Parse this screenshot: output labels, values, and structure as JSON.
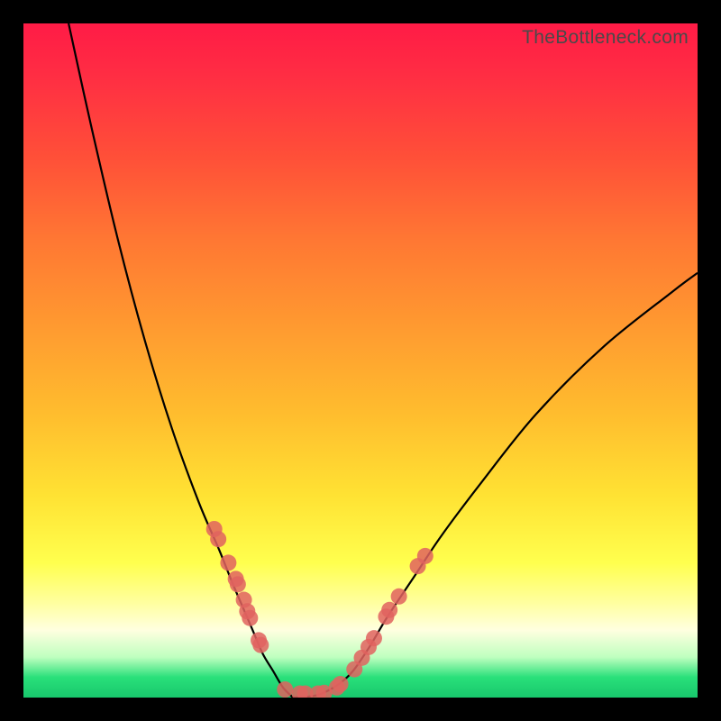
{
  "watermark": "TheBottleneck.com",
  "colors": {
    "frame": "#000000",
    "curve": "#000000",
    "dot": "#e0635f"
  },
  "chart_data": {
    "type": "line",
    "title": "",
    "xlabel": "",
    "ylabel": "",
    "xlim": [
      0,
      100
    ],
    "ylim": [
      0,
      100
    ],
    "series": [
      {
        "name": "left-curve",
        "x": [
          6.7,
          10,
          14,
          18,
          22,
          26,
          29,
          31,
          32.5,
          34,
          35.5,
          37,
          38.5,
          40
        ],
        "y": [
          100,
          85,
          68,
          53,
          40,
          29,
          22,
          17,
          13.5,
          10,
          6.5,
          4,
          1.5,
          0
        ]
      },
      {
        "name": "right-curve",
        "x": [
          40,
          44,
          48,
          51,
          54,
          58,
          62,
          68,
          76,
          86,
          96,
          100
        ],
        "y": [
          0,
          0.5,
          3,
          7,
          12,
          18,
          24,
          32,
          42,
          52,
          60,
          63
        ]
      }
    ],
    "points": [
      {
        "name": "left-cluster",
        "coords": [
          {
            "x": 28.3,
            "y": 25
          },
          {
            "x": 28.9,
            "y": 23.5
          },
          {
            "x": 30.4,
            "y": 20
          },
          {
            "x": 31.5,
            "y": 17.6
          },
          {
            "x": 31.8,
            "y": 16.8
          },
          {
            "x": 32.7,
            "y": 14.5
          },
          {
            "x": 33.2,
            "y": 12.8
          },
          {
            "x": 33.6,
            "y": 11.8
          },
          {
            "x": 34.9,
            "y": 8.5
          },
          {
            "x": 35.2,
            "y": 7.8
          }
        ]
      },
      {
        "name": "bottom-cluster",
        "coords": [
          {
            "x": 38.8,
            "y": 1.2
          },
          {
            "x": 41.0,
            "y": 0.6
          },
          {
            "x": 41.8,
            "y": 0.6
          },
          {
            "x": 43.7,
            "y": 0.6
          },
          {
            "x": 44.6,
            "y": 0.7
          },
          {
            "x": 46.5,
            "y": 1.5
          },
          {
            "x": 47.0,
            "y": 2.0
          }
        ]
      },
      {
        "name": "right-cluster",
        "coords": [
          {
            "x": 49.1,
            "y": 4.2
          },
          {
            "x": 50.2,
            "y": 5.9
          },
          {
            "x": 51.2,
            "y": 7.5
          },
          {
            "x": 52.0,
            "y": 8.8
          },
          {
            "x": 53.8,
            "y": 12.0
          },
          {
            "x": 54.3,
            "y": 13.0
          },
          {
            "x": 55.7,
            "y": 15.0
          },
          {
            "x": 58.5,
            "y": 19.5
          },
          {
            "x": 59.6,
            "y": 21.0
          }
        ]
      }
    ]
  }
}
